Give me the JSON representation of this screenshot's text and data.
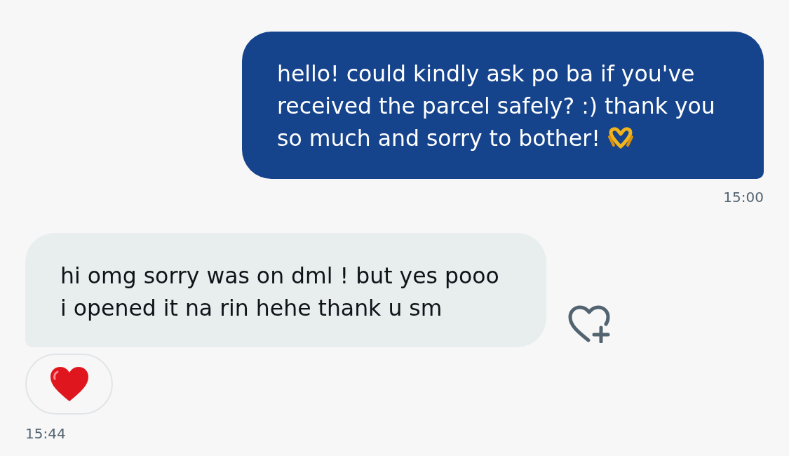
{
  "messages": [
    {
      "kind": "outgoing",
      "text": "hello! could kindly ask po ba if you've\nreceived the parcel safely? :) thank you\nso much and sorry to bother!",
      "ends_with_emoji": true,
      "react_button": false,
      "reacted": false,
      "time": "15:00"
    },
    {
      "kind": "incoming",
      "text": "hi omg sorry was on dml ! but yes pooo\ni opened it na rin hehe thank u sm",
      "ends_with_emoji": false,
      "react_button": true,
      "reacted": true,
      "time": "15:44"
    }
  ]
}
